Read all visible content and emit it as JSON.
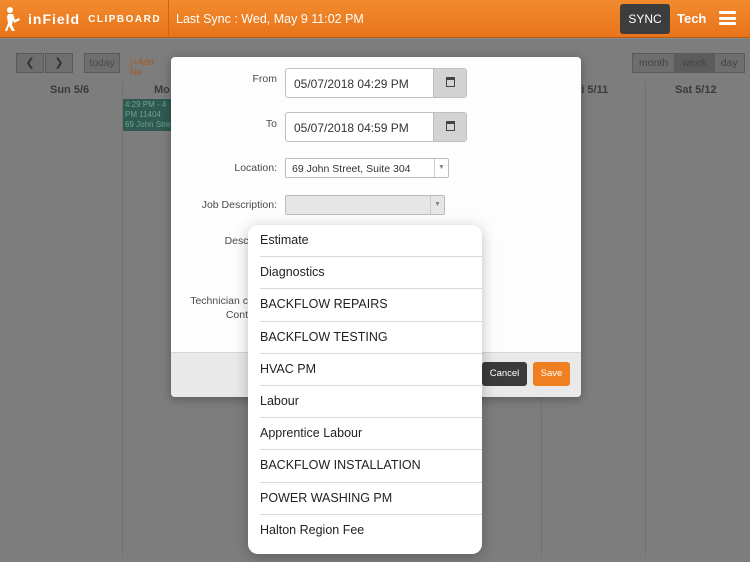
{
  "topbar": {
    "logo_primary": "inField",
    "logo_secondary": "CLIPBOARD",
    "last_sync": "Last Sync : Wed, May 9 11:02 PM",
    "sync_label": "SYNC",
    "user_label": "Tech"
  },
  "calendar": {
    "today_label": "today",
    "add_new_label": "[+Add Ne",
    "views": [
      "month",
      "week",
      "day"
    ],
    "active_view": "week",
    "day_headers": [
      "Sun 5/6",
      "Mo",
      "ri 5/11",
      "Sat 5/12"
    ],
    "event_text": "4:29 PM - 4 PM  11404 69 John Stre"
  },
  "modal": {
    "from_label": "From",
    "from_value": "05/07/2018 04:29 PM",
    "to_label": "To",
    "to_value": "05/07/2018 04:59 PM",
    "location_label": "Location:",
    "location_value": "69 John Street, Suite 304",
    "job_description_label": "Job Description:",
    "job_description_value": "",
    "description_label_partial": "Descr",
    "technician_label_partial": "Technician c",
    "contact_label_partial": "Cont",
    "cancel_label": "Cancel",
    "save_label": "Save"
  },
  "dropdown": {
    "options": [
      "Estimate",
      "Diagnostics",
      "BACKFLOW REPAIRS",
      "BACKFLOW TESTING",
      "HVAC PM",
      "Labour",
      "Apprentice Labour",
      "BACKFLOW INSTALLATION",
      "POWER WASHING PM",
      "Halton Region Fee"
    ]
  },
  "colors": {
    "brand_orange": "#f07f22",
    "dark_button": "#3b3b3b"
  }
}
